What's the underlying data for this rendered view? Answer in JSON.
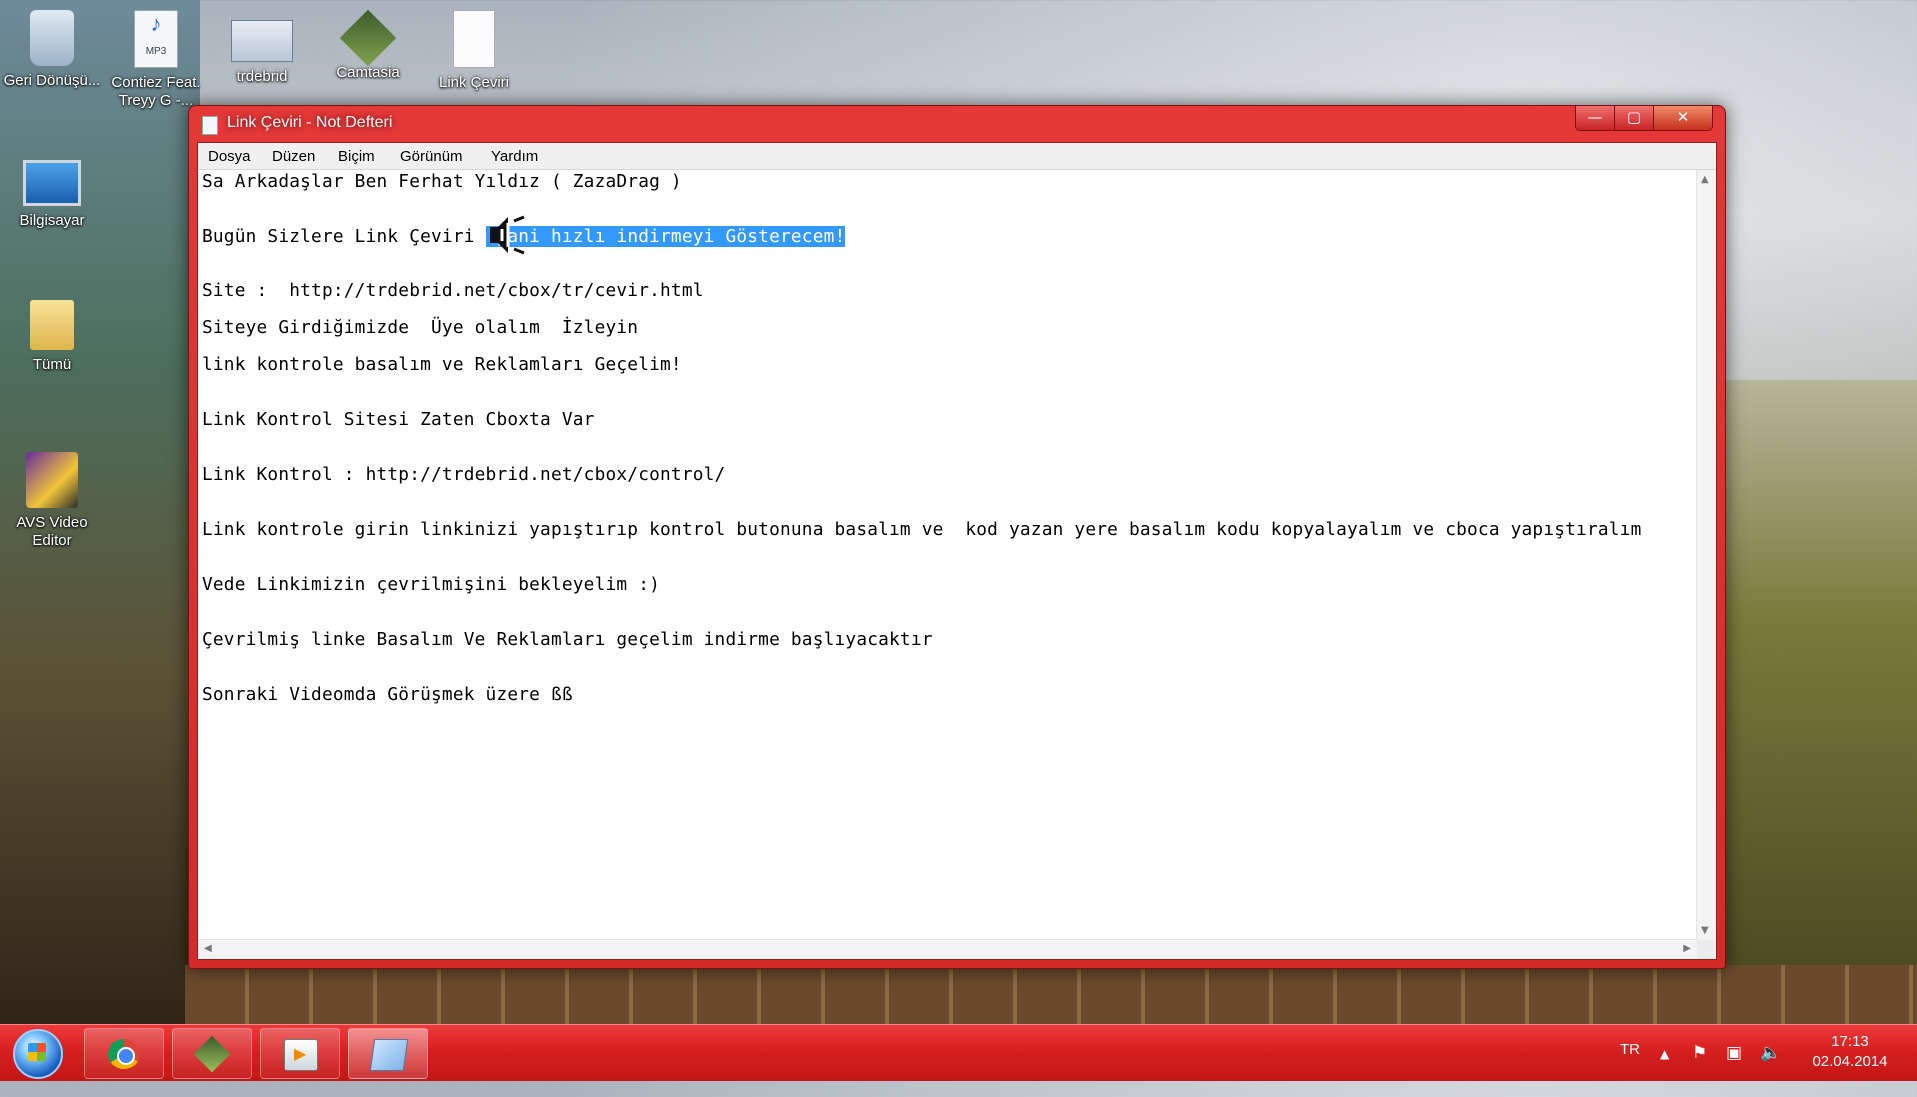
{
  "desktop": {
    "icons": [
      {
        "label": "Geri Dönüşü...",
        "icon": "recycle-bin-icon"
      },
      {
        "label": "Contiez Feat. Treyy G -...",
        "icon": "mp3-file-icon"
      },
      {
        "label": "trdebrid",
        "icon": "web-shortcut-icon"
      },
      {
        "label": "Camtasia",
        "icon": "camtasia-icon"
      },
      {
        "label": "Link Çeviri",
        "icon": "text-file-icon"
      },
      {
        "label": "Bilgisayar",
        "icon": "computer-icon"
      },
      {
        "label": "Tümü",
        "icon": "folder-icon"
      },
      {
        "label": "AVS Video Editor",
        "icon": "avs-video-editor-icon"
      }
    ]
  },
  "window": {
    "title": "Link Çeviri - Not Defteri",
    "controls": {
      "minimize": "—",
      "maximize": "▢",
      "close": "✕"
    },
    "menu": [
      "Dosya",
      "Düzen",
      "Biçim",
      "Görünüm",
      "Yardım"
    ],
    "lines": {
      "l1": "Sa Arkadaşlar Ben Ferhat Yıldız ( ZazaDrag )",
      "l2_before": "Bugün Sizlere Link Çeviri ",
      "l2_selected": " yani hızlı indirmeyi Gösterecem!",
      "l3": "Site :  http://trdebrid.net/cbox/tr/cevir.html",
      "l4": "Siteye Girdiğimizde  Üye olalım  İzleyin",
      "l5": "link kontrole basalım ve Reklamları Geçelim!",
      "l6": "Link Kontrol Sitesi Zaten Cboxta Var",
      "l7": "Link Kontrol : http://trdebrid.net/cbox/control/",
      "l8": "Link kontrole girin linkinizi yapıştırıp kontrol butonuna basalım ve  kod yazan yere basalım kodu kopyalayalım ve cboca yapıştıralım",
      "l9": "Vede Linkimizin çevrilmişini bekleyelim :)",
      "l10": "Çevrilmiş linke Basalım Ve Reklamları geçelim indirme başlıyacaktır",
      "l11": "Sonraki Videomda Görüşmek üzere ßß"
    }
  },
  "taskbar": {
    "buttons": [
      "start-button",
      "chrome",
      "camtasia",
      "media-player",
      "notepad"
    ],
    "language": "TR",
    "tray_icons": {
      "show_hidden": "▲",
      "action_center": "⚑",
      "network": "▣",
      "volume": "🔈"
    },
    "time": "17:13",
    "date": "02.04.2014"
  },
  "colors": {
    "window_chrome": "#d42a2a",
    "taskbar": "#d51e1e",
    "selection": "#3399ff"
  }
}
